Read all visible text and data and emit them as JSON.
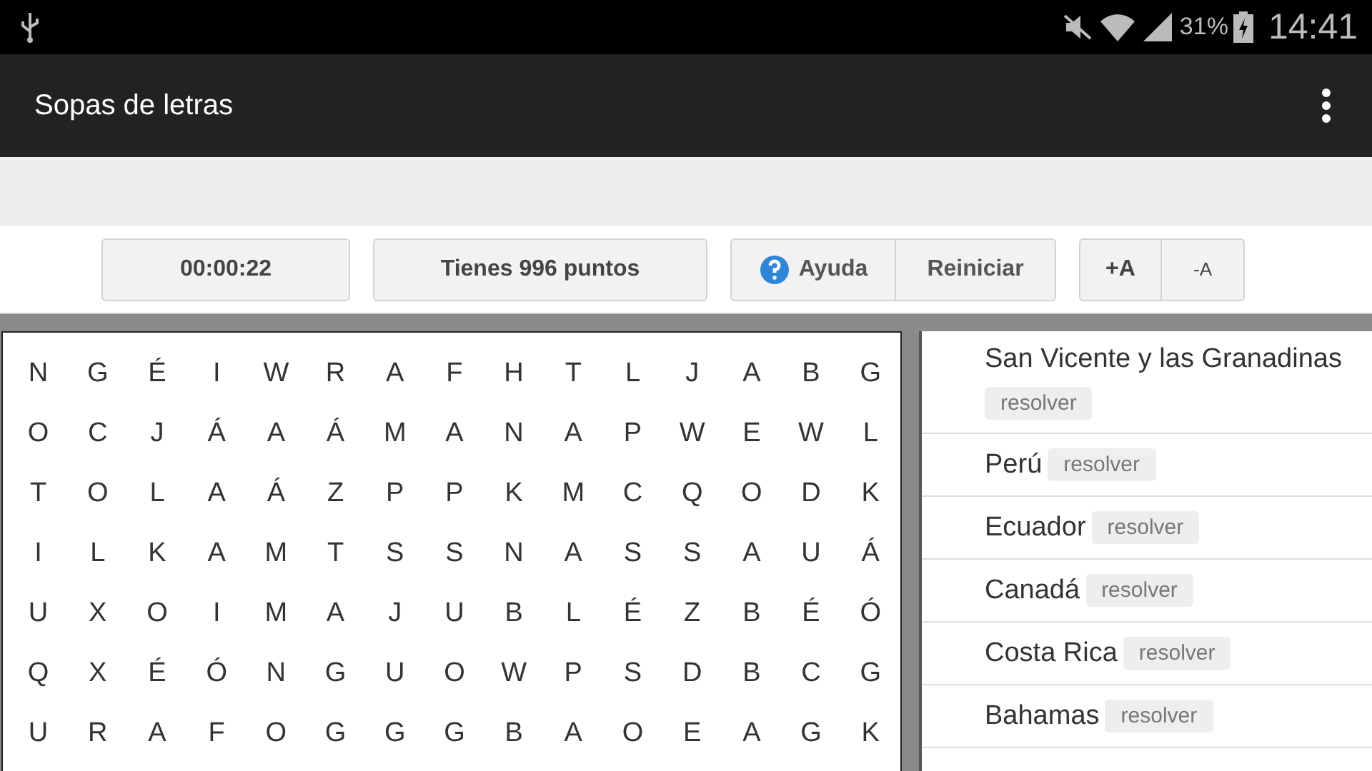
{
  "status_bar": {
    "battery_text": "31%",
    "time": "14:41"
  },
  "app_bar": {
    "title": "Sopas de letras"
  },
  "toolbar": {
    "timer": "00:00:22",
    "score": "Tienes 996 puntos",
    "help": "Ayuda",
    "restart": "Reiniciar",
    "font_bigger": "+A",
    "font_smaller": "-A"
  },
  "grid": [
    [
      "N",
      "G",
      "É",
      "I",
      "W",
      "R",
      "A",
      "F",
      "H",
      "T",
      "L",
      "J",
      "A",
      "B",
      "G"
    ],
    [
      "O",
      "C",
      "J",
      "Á",
      "A",
      "Á",
      "M",
      "A",
      "N",
      "A",
      "P",
      "W",
      "E",
      "W",
      "L"
    ],
    [
      "T",
      "O",
      "L",
      "A",
      "Á",
      "Z",
      "P",
      "P",
      "K",
      "M",
      "C",
      "Q",
      "O",
      "D",
      "K"
    ],
    [
      "I",
      "L",
      "K",
      "A",
      "M",
      "T",
      "S",
      "S",
      "N",
      "A",
      "S",
      "S",
      "A",
      "U",
      "Á"
    ],
    [
      "U",
      "X",
      "O",
      "I",
      "M",
      "A",
      "J",
      "U",
      "B",
      "L",
      "É",
      "Z",
      "B",
      "É",
      "Ó"
    ],
    [
      "Q",
      "X",
      "É",
      "Ó",
      "N",
      "G",
      "U",
      "O",
      "W",
      "P",
      "S",
      "D",
      "B",
      "C",
      "G"
    ],
    [
      "U",
      "R",
      "A",
      "F",
      "O",
      "G",
      "G",
      "G",
      "B",
      "A",
      "O",
      "E",
      "A",
      "G",
      "K"
    ]
  ],
  "words": [
    {
      "name": "San Vicente y las Granadinas",
      "action": "resolver"
    },
    {
      "name": "Perú",
      "action": "resolver"
    },
    {
      "name": "Ecuador",
      "action": "resolver"
    },
    {
      "name": "Canadá",
      "action": "resolver"
    },
    {
      "name": "Costa Rica",
      "action": "resolver"
    },
    {
      "name": "Bahamas",
      "action": "resolver"
    }
  ]
}
